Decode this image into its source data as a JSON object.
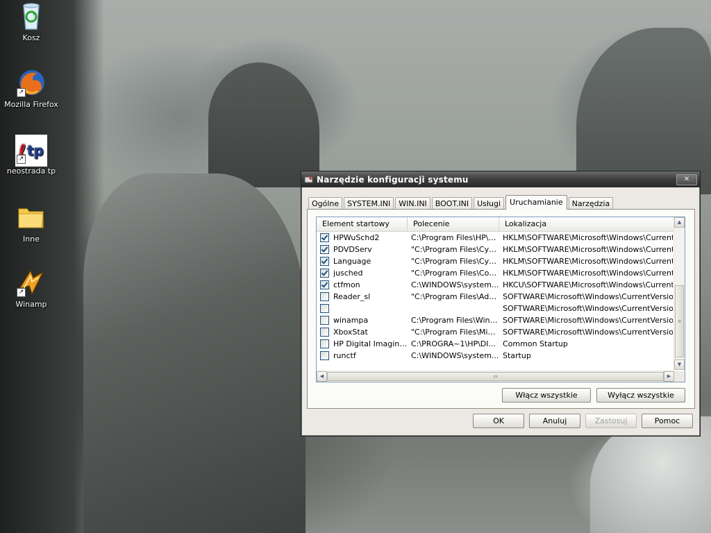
{
  "desktop": {
    "icons": [
      {
        "label": "Kosz",
        "icon": "recycle-bin-icon"
      },
      {
        "label": "Mozilla Firefox",
        "icon": "firefox-icon"
      },
      {
        "label": "neostrada tp",
        "icon": "neostrada-icon"
      },
      {
        "label": "Inne",
        "icon": "folder-icon"
      },
      {
        "label": "Winamp",
        "icon": "winamp-icon"
      }
    ]
  },
  "window": {
    "title": "Narzędzie konfiguracji systemu",
    "close_label": "✕",
    "tabs": [
      "Ogólne",
      "SYSTEM.INI",
      "WIN.INI",
      "BOOT.INI",
      "Usługi",
      "Uruchamianie",
      "Narzędzia"
    ],
    "active_tab": "Uruchamianie",
    "columns": [
      "Element startowy",
      "Polecenie",
      "Lokalizacja"
    ],
    "rows": [
      {
        "checked": true,
        "name": "HPWuSchd2",
        "command": "C:\\Program Files\\HP\\H...",
        "location": "HKLM\\SOFTWARE\\Microsoft\\Windows\\CurrentVer..."
      },
      {
        "checked": true,
        "name": "PDVDServ",
        "command": "\"C:\\Program Files\\Cyb...",
        "location": "HKLM\\SOFTWARE\\Microsoft\\Windows\\CurrentVer..."
      },
      {
        "checked": true,
        "name": "Language",
        "command": "\"C:\\Program Files\\Cyb...",
        "location": "HKLM\\SOFTWARE\\Microsoft\\Windows\\CurrentVer..."
      },
      {
        "checked": true,
        "name": "jusched",
        "command": "\"C:\\Program Files\\Com...",
        "location": "HKLM\\SOFTWARE\\Microsoft\\Windows\\CurrentVer..."
      },
      {
        "checked": true,
        "name": "ctfmon",
        "command": "C:\\WINDOWS\\system...",
        "location": "HKCU\\SOFTWARE\\Microsoft\\Windows\\CurrentVer..."
      },
      {
        "checked": false,
        "name": "Reader_sl",
        "command": "\"C:\\Program Files\\Ado...",
        "location": "SOFTWARE\\Microsoft\\Windows\\CurrentVersion\\Ru"
      },
      {
        "checked": false,
        "name": "",
        "command": "",
        "location": "SOFTWARE\\Microsoft\\Windows\\CurrentVersion\\Ru"
      },
      {
        "checked": false,
        "name": "winampa",
        "command": "C:\\Program Files\\Wina...",
        "location": "SOFTWARE\\Microsoft\\Windows\\CurrentVersion\\Ru"
      },
      {
        "checked": false,
        "name": "XboxStat",
        "command": "\"C:\\Program Files\\Micr...",
        "location": "SOFTWARE\\Microsoft\\Windows\\CurrentVersion\\Ru"
      },
      {
        "checked": false,
        "name": "HP Digital Imaging ...",
        "command": "C:\\PROGRA~1\\HP\\DI...",
        "location": "Common Startup"
      },
      {
        "checked": false,
        "name": "runctf",
        "command": "C:\\WINDOWS\\system...",
        "location": "Startup"
      }
    ],
    "enable_all_label": "Włącz wszystkie",
    "disable_all_label": "Wyłącz wszystkie",
    "ok_label": "OK",
    "cancel_label": "Anuluj",
    "apply_label": "Zastosuj",
    "help_label": "Pomoc"
  }
}
